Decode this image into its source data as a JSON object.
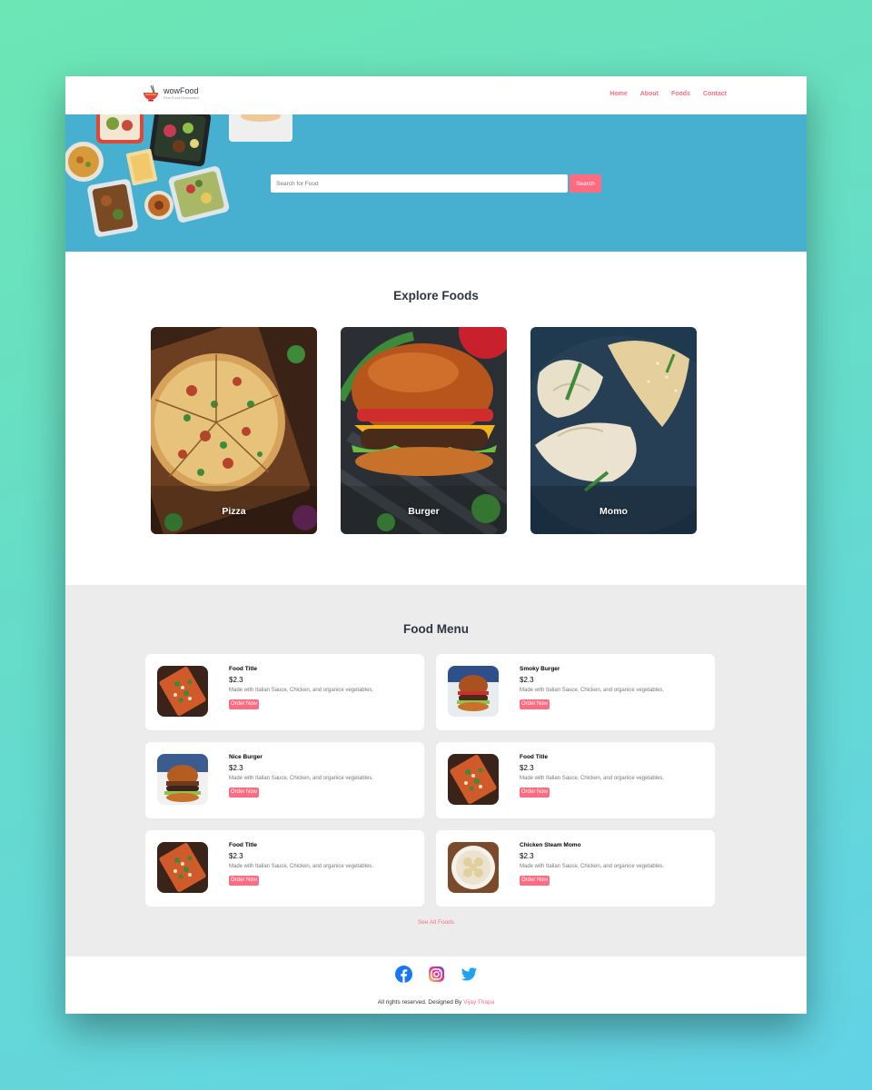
{
  "brand": {
    "name": "wowFood",
    "tagline": "Fine Food Restaurant"
  },
  "nav": {
    "items": [
      "Home",
      "About",
      "Foods",
      "Contact"
    ]
  },
  "search": {
    "placeholder": "Search for Food",
    "button": "Search"
  },
  "explore": {
    "title": "Explore Foods",
    "categories": [
      "Pizza",
      "Burger",
      "Momo"
    ]
  },
  "food_menu": {
    "title": "Food Menu",
    "items": [
      {
        "title": "Food Title",
        "price": "$2.3",
        "description": "Made with Italian Sauce, Chicken, and organice vegetables.",
        "button": "Order Now",
        "image": "pizza"
      },
      {
        "title": "Smoky Burger",
        "price": "$2.3",
        "description": "Made with Italian Sauce, Chicken, and organice vegetables.",
        "button": "Order Now",
        "image": "burger"
      },
      {
        "title": "Nice Burger",
        "price": "$2.3",
        "description": "Made with Italian Sauce, Chicken, and organice vegetables.",
        "button": "Order Now",
        "image": "burger"
      },
      {
        "title": "Food Title",
        "price": "$2.3",
        "description": "Made with Italian Sauce, Chicken, and organice vegetables.",
        "button": "Order Now",
        "image": "pizza"
      },
      {
        "title": "Food Title",
        "price": "$2.3",
        "description": "Made with Italian Sauce, Chicken, and organice vegetables.",
        "button": "Order Now",
        "image": "pizza"
      },
      {
        "title": "Chicken Steam Momo",
        "price": "$2.3",
        "description": "Made with Italian Sauce, Chicken, and organice vegetables.",
        "button": "Order Now",
        "image": "momo"
      }
    ],
    "see_all": "See All Foods"
  },
  "footer": {
    "social_icons": [
      "facebook-icon",
      "instagram-icon",
      "twitter-icon"
    ],
    "credits_text": "All rights reserved. Designed By",
    "author": "Vijay Thapa"
  },
  "colors": {
    "accent": "#ff6b81",
    "hero_bg": "#47b0d0",
    "menu_bg": "#ececec",
    "heading": "#2f3542"
  }
}
